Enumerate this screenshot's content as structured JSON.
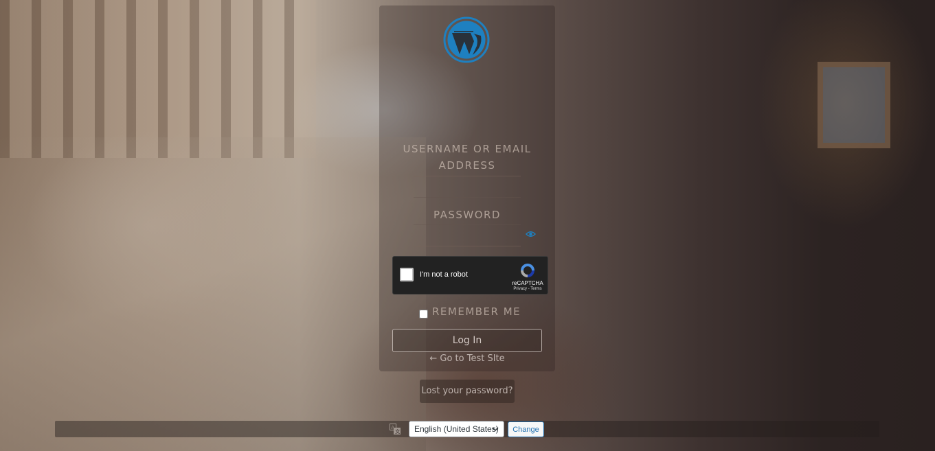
{
  "form": {
    "username_label": "USERNAME OR EMAIL ADDRESS",
    "username_value": "",
    "password_label": "PASSWORD",
    "password_value": "",
    "remember_label": "REMEMBER ME",
    "remember_checked": false,
    "login_button": "Log In",
    "back_link": "← Go to Test SIte",
    "lost_password": "Lost your password?"
  },
  "recaptcha": {
    "label": "I'm not a robot",
    "brand": "reCAPTCHA",
    "links": "Privacy - Terms"
  },
  "language": {
    "selected": "English (United States)",
    "change_button": "Change"
  },
  "icons": {
    "logo": "wordpress-logo",
    "show_password": "eye-icon",
    "language": "translation-icon",
    "dropdown": "chevron-down-icon"
  },
  "colors": {
    "wp_blue": "#1e80c0",
    "change_button": "#2271b1"
  }
}
